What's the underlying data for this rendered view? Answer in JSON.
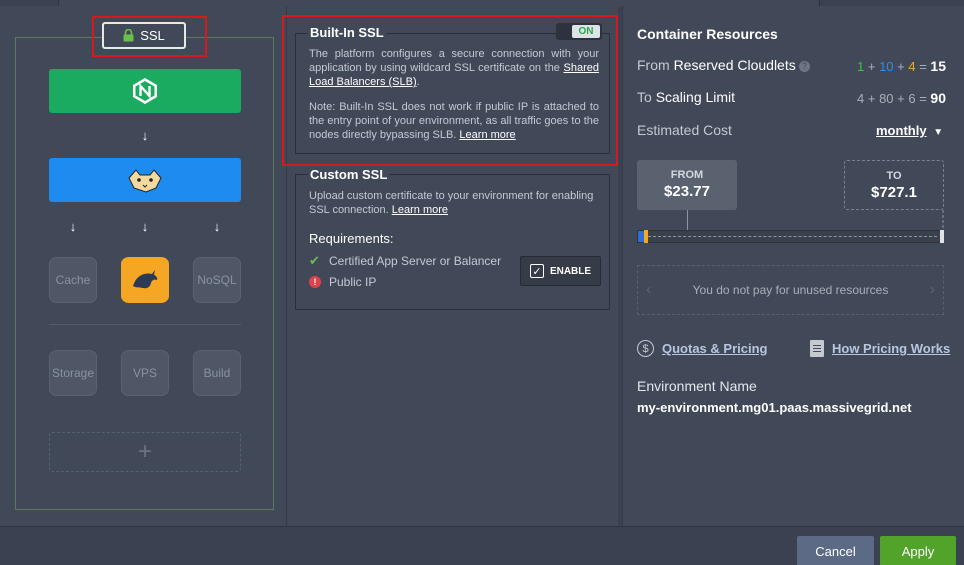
{
  "topology": {
    "ssl_label": "SSL",
    "nodes": {
      "cache": "Cache",
      "nosql": "NoSQL",
      "storage": "Storage",
      "vps": "VPS",
      "build": "Build"
    },
    "add_symbol": "+"
  },
  "builtin_ssl": {
    "title": "Built-In SSL",
    "toggle_state": "ON",
    "desc1_text": "The platform configures a secure connection with your application by using wildcard SSL certificate on the ",
    "desc1_link": "Shared Load Balancers (SLB)",
    "desc1_end": ".",
    "note_text": "Note: Built-In SSL does not work if public IP is attached to the entry point of your environment, as all traffic goes to the nodes directly bypassing SLB. ",
    "note_link": "Learn more"
  },
  "custom_ssl": {
    "title": "Custom SSL",
    "desc_text": "Upload custom certificate to your environment for enabling SSL connection. ",
    "desc_link": "Learn more",
    "requirements_title": "Requirements:",
    "req1": "Certified App Server or Balancer",
    "req2": "Public IP",
    "enable_label": "ENABLE"
  },
  "resources": {
    "title": "Container Resources",
    "reserved_label_prefix": "From",
    "reserved_label": "Reserved Cloudlets",
    "reserved_calc": {
      "a": "1",
      "b": "10",
      "c": "4",
      "total": "15"
    },
    "scaling_label_prefix": "To",
    "scaling_label": "Scaling Limit",
    "scaling_calc": {
      "a": "4",
      "b": "80",
      "c": "6",
      "total": "90"
    },
    "cost_label": "Estimated Cost",
    "period": "monthly",
    "from_label": "FROM",
    "from_value": "$23.77",
    "to_label": "TO",
    "to_value": "$727.1",
    "unused_text": "You do not pay for unused resources",
    "quotas_link": "Quotas & Pricing",
    "pricing_link": "How Pricing Works",
    "env_label": "Environment Name",
    "env_value": "my-environment.mg01.paas.massivegrid.net"
  },
  "colors": {
    "green_cloudlet": "#3fbf4a",
    "blue_cloudlet": "#2a8cf0",
    "orange_cloudlet": "#f5a623"
  },
  "buttons": {
    "cancel": "Cancel",
    "apply": "Apply"
  }
}
